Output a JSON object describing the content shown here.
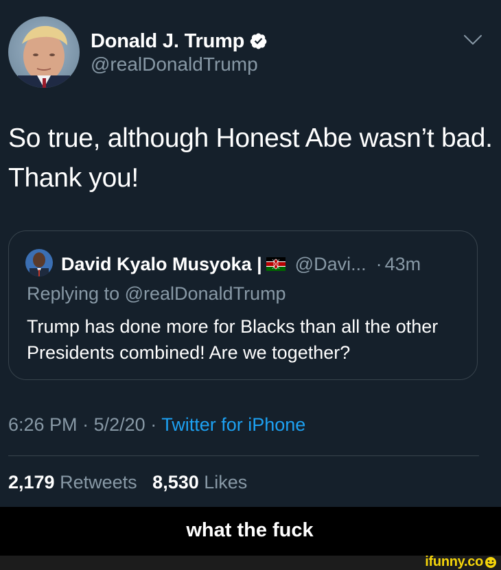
{
  "tweet": {
    "author": {
      "display_name": "Donald J. Trump",
      "handle": "@realDonaldTrump",
      "verified_icon": "verified-badge-icon",
      "avatar": "trump-avatar"
    },
    "menu_icon": "chevron-down-icon",
    "text": "So true, although Honest Abe wasn’t bad. Thank you!",
    "quoted_tweet": {
      "author_name": "David Kyalo Musyoka |",
      "flag_icon": "kenya-flag-icon",
      "handle": "@Davi...",
      "separator": "·",
      "time": "43m",
      "replying_to": "Replying to @realDonaldTrump",
      "text": "Trump has done more for Blacks than all the other Presidents combined! Are we together?"
    },
    "meta": {
      "time": "6:26 PM",
      "separator": "·",
      "date": "5/2/20",
      "source": "Twitter for iPhone"
    },
    "stats": {
      "retweets_count": "2,179",
      "retweets_label": "Retweets",
      "likes_count": "8,530",
      "likes_label": "Likes"
    }
  },
  "caption": "what the fuck",
  "watermark": "ifunny.co",
  "colors": {
    "background": "#15202b",
    "primary_text": "#ffffff",
    "secondary_text": "#8899a6",
    "link": "#1da1f2",
    "border": "#38444d",
    "watermark": "#f5d50a"
  }
}
